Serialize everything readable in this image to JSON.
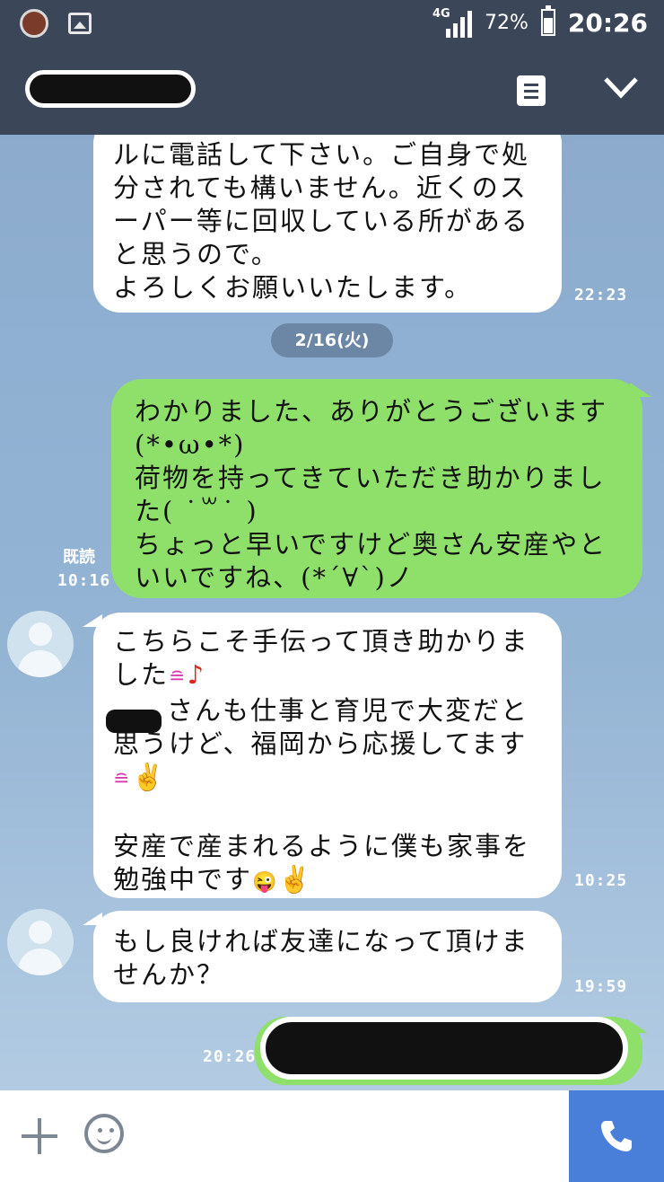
{
  "status_bar": {
    "network": "4G",
    "battery_pct": "72%",
    "battery_level": 0.72,
    "time": "20:26"
  },
  "header": {
    "icons": [
      "note-icon",
      "chevron-down-icon"
    ]
  },
  "chat": {
    "date_separator": "2/16(火)",
    "messages": [
      {
        "sender": "other",
        "text": "ルに電話して下さい。ご自身で処\n分されても構いません。近くのス\nーパー等に回収している所がある\nと思うので。\nよろしくお願いいたします。",
        "time": "22:23"
      },
      {
        "sender": "me",
        "text": "わかりました、ありがとうございます\n(*•ω•*)\n荷物を持ってきていただき助かりまし\nた( ˙꒳˙ )\nちょっと早いですけど奥さん安産やと\nいいですね、(*´∀`)ノ",
        "read_label": "既読",
        "time": "10:16"
      },
      {
        "sender": "other",
        "line1": "こちらこそ手伝って頂き助かりま",
        "line2": "した",
        "line3": "さんも仕事と育児で大変だと",
        "line4": "思うけど、福岡から応援してます",
        "line5": "安産で産まれるように僕も家事を",
        "line6": "勉強中です",
        "time": "10:25"
      },
      {
        "sender": "other",
        "text": "もし良ければ友達になって頂けま\nせんか？",
        "time": "19:59"
      },
      {
        "sender": "me",
        "time": "20:26"
      }
    ],
    "emoji": {
      "smile": "≘",
      "note": "♪",
      "victory": "✌",
      "tongue": "😜"
    }
  },
  "input_bar": {
    "icons": [
      "plus-icon",
      "emoji-icon",
      "phone-icon"
    ]
  },
  "colors": {
    "header_bg": "#3b4658",
    "outgoing_bubble": "#8fe06a",
    "incoming_bubble": "#ffffff",
    "call_button": "#4a7fd9"
  }
}
